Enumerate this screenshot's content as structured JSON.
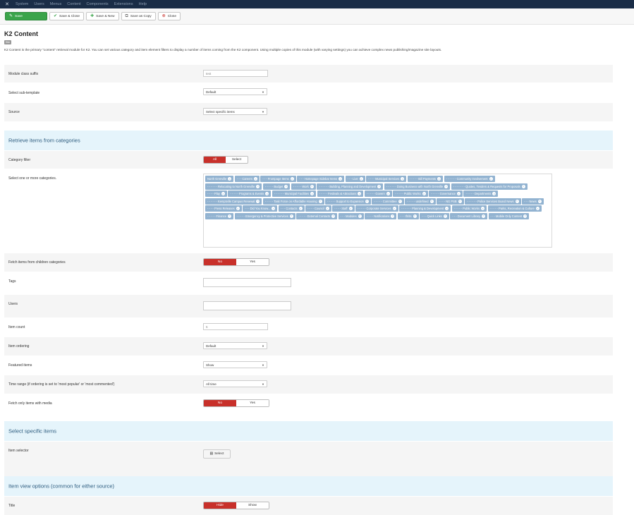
{
  "topbar": {
    "menu": [
      "System",
      "Users",
      "Menus",
      "Content",
      "Components",
      "Extensions",
      "Help"
    ]
  },
  "toolbar": {
    "save": "Save",
    "save_close": "Save & Close",
    "save_new": "Save & New",
    "save_copy": "Save as Copy",
    "close": "Close"
  },
  "page": {
    "title": "K2 Content",
    "badge": "Site",
    "description": "K2 Content is the primary \"content\" retrieval module for K2. You can set various category and item element filters to display a number of items coming from the K2 component. Using multiple copies of this module (with varying settings) you can achieve complex news publishing/magazine site layouts."
  },
  "fields": {
    "module_class_suffix": {
      "label": "Module class suffix",
      "value": "test"
    },
    "sub_template": {
      "label": "Select sub-template",
      "value": "Default"
    },
    "source": {
      "label": "Source",
      "value": "Select specific items"
    }
  },
  "sections": {
    "retrieve": "Retrieve items from categories",
    "specific": "Select specific items",
    "view": "Item view options (common for either source)"
  },
  "category_filter": {
    "label": "Category filter",
    "options": [
      "All",
      "Select"
    ],
    "selected": "All"
  },
  "categories": {
    "label": "Select one or more categories.",
    "items": [
      "North Grenville",
      "- - - Careers",
      "- - - Frontpage Items",
      "- - - Homepage Sidebar Items",
      "- - - Live",
      "- - - - Municipal Services",
      "- - - - - Bill Payments",
      "- - - - - - Community Involvement",
      "- - - - - - Relocating to North Grenville",
      "- - - - - Budget",
      "- - - - - Work",
      "- - - - - - Building, Planning and Development",
      "- - - - - - Doing Business with North Grenville",
      "- - - - - - - Quotes, Tenders & Requests for Proposals",
      "- - - - Play",
      "- - - - - Programs & Events",
      "- - - - - - Municipal Facilities",
      "- - - - - Festivals & Attractions",
      "- - - - - Govern",
      "- - - - - Public Works",
      "- - - - - Governance",
      "- - - - - Departments",
      "- - - - - - Kemptville Campus Renewal",
      "- - - - - Task Force on Affordable Housing",
      "- - - - - Support to Expansion",
      "- - - - - Committee",
      "- - - - - undefined",
      "- - - - NG PSB",
      "- - - - - - Police Services Board News",
      "- - - News",
      "- - - - Press Releases",
      "- - - Did You Know...",
      "- - - Contacts",
      "- - - - Council",
      "- - - - Staff",
      "- - - - - Corporate Services",
      "- - - - - - Planning & Development",
      "- - - - - Public Works",
      "- - - - - Parks, Recreation & Culture",
      "- - - - - Finance",
      "- - - - - Emergency & Protective Services",
      "- - - - - External Contacts",
      "- - - Modules",
      "- - - - Notifications",
      "- - - Ifrrits",
      "- - - Quick Links",
      "- - - Document Library",
      "- - - Mobile Only Content"
    ]
  },
  "fetch_children": {
    "label": "Fetch items from children categories",
    "options": [
      "No",
      "Yes"
    ],
    "selected": "No"
  },
  "tags": {
    "label": "Tags",
    "value": ""
  },
  "users": {
    "label": "Users",
    "value": ""
  },
  "item_count": {
    "label": "Item count",
    "value": "5"
  },
  "item_ordering": {
    "label": "Item ordering",
    "value": "Default"
  },
  "featured": {
    "label": "Featured items",
    "value": "Show"
  },
  "time_range": {
    "label": "Time range (if ordering is set to 'most popular' or 'most commented')",
    "value": "All time"
  },
  "media_only": {
    "label": "Fetch only items with media",
    "options": [
      "No",
      "Yes"
    ],
    "selected": "No"
  },
  "item_selector": {
    "label": "Item selector",
    "button": "Select"
  },
  "title_opt": {
    "label": "Title",
    "options": [
      "Hide",
      "Show"
    ],
    "selected": "Hide"
  },
  "colors": {
    "topbar": "#1a2d47",
    "save": "#3aa44a",
    "toggle_on": "#c8302a",
    "chip": "#92b3d1",
    "section": "#e5f4fb"
  }
}
